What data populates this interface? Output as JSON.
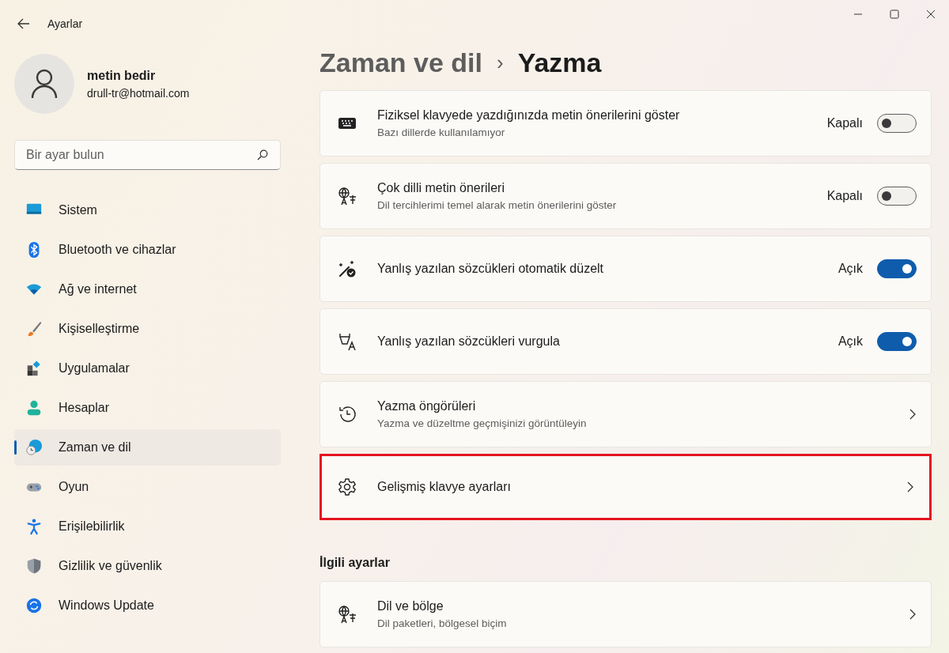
{
  "window": {
    "title": "Ayarlar"
  },
  "user": {
    "name": "metin bedir",
    "email": "drull-tr@hotmail.com"
  },
  "search": {
    "placeholder": "Bir ayar bulun"
  },
  "sidebar": {
    "items": [
      {
        "label": "Sistem",
        "selected": false
      },
      {
        "label": "Bluetooth ve cihazlar",
        "selected": false
      },
      {
        "label": "Ağ ve internet",
        "selected": false
      },
      {
        "label": "Kişiselleştirme",
        "selected": false
      },
      {
        "label": "Uygulamalar",
        "selected": false
      },
      {
        "label": "Hesaplar",
        "selected": false
      },
      {
        "label": "Zaman ve dil",
        "selected": true
      },
      {
        "label": "Oyun",
        "selected": false
      },
      {
        "label": "Erişilebilirlik",
        "selected": false
      },
      {
        "label": "Gizlilik ve güvenlik",
        "selected": false
      },
      {
        "label": "Windows Update",
        "selected": false
      }
    ]
  },
  "breadcrumb": {
    "parent": "Zaman ve dil",
    "separator": "›",
    "current": "Yazma"
  },
  "settings": [
    {
      "kind": "toggle",
      "title": "Fiziksel klavyede yazdığınızda metin önerilerini göster",
      "subtitle": "Bazı dillerde kullanılamıyor",
      "state_label": "Kapalı",
      "on": false
    },
    {
      "kind": "toggle",
      "title": "Çok dilli metin önerileri",
      "subtitle": "Dil tercihlerimi temel alarak metin önerilerini göster",
      "state_label": "Kapalı",
      "on": false
    },
    {
      "kind": "toggle",
      "title": "Yanlış yazılan sözcükleri otomatik düzelt",
      "state_label": "Açık",
      "on": true
    },
    {
      "kind": "toggle",
      "title": "Yanlış yazılan sözcükleri vurgula",
      "state_label": "Açık",
      "on": true
    },
    {
      "kind": "link",
      "title": "Yazma öngörüleri",
      "subtitle": "Yazma ve düzeltme geçmişinizi görüntüleyin",
      "highlighted": false
    },
    {
      "kind": "link",
      "title": "Gelişmiş klavye ayarları",
      "highlighted": true
    }
  ],
  "related": {
    "heading": "İlgili ayarlar",
    "items": [
      {
        "kind": "link",
        "title": "Dil ve bölge",
        "subtitle": "Dil paketleri, bölgesel biçim",
        "highlighted": false
      }
    ]
  }
}
